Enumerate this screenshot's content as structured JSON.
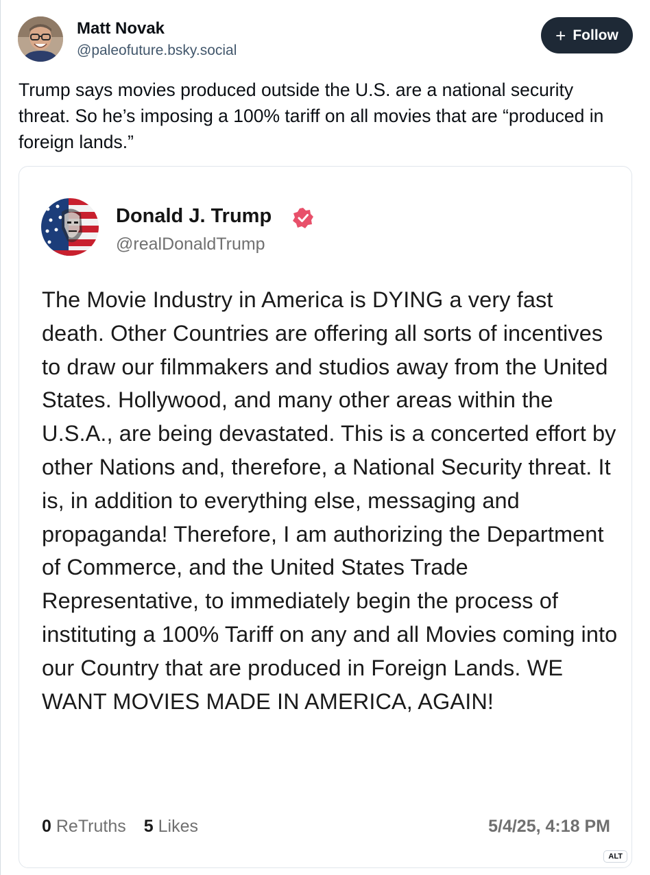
{
  "post": {
    "author": {
      "name": "Matt Novak",
      "handle": "@paleofuture.bsky.social"
    },
    "follow_button": {
      "icon": "plus-icon",
      "label": "Follow"
    },
    "text": "Trump says movies produced outside the U.S. are a national security threat. So he’s imposing a 100% tariff on all movies that are “produced in foreign lands.”",
    "embed_image": {
      "alt_badge": "ALT",
      "truth_post": {
        "author_name": "Donald J. Trump",
        "verified_icon": "verified-badge-icon",
        "handle": "@realDonaldTrump",
        "body": "The Movie Industry in America is DYING a very fast death. Other Countries are offering all sorts of incentives to draw our filmmakers and studios away from the United States. Hollywood, and many other areas within the U.S.A., are being devastated. This is a concerted effort by other Nations and, therefore, a National Security threat. It is, in addition to everything else, messaging and propaganda! Therefore, I am authorizing the Department of Commerce, and the United States Trade Representative, to immediately begin the process of instituting a 100% Tariff on any and all Movies coming into our Country that are produced in Foreign Lands. WE WANT MOVIES MADE IN AMERICA, AGAIN!",
        "retruths_count": "0",
        "retruths_label": "ReTruths",
        "likes_count": "5",
        "likes_label": "Likes",
        "timestamp": "5/4/25, 4:18 PM"
      }
    }
  },
  "colors": {
    "follow_bg": "#1e2936",
    "verified_badge": "#e8506a",
    "handle_gray": "#42576c"
  }
}
